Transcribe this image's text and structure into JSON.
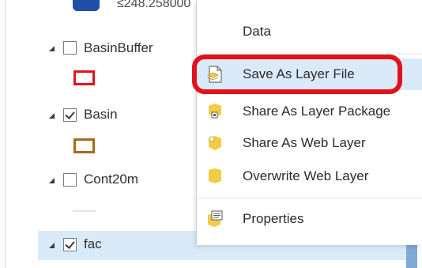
{
  "contents": {
    "prev_legend_label": "≤248.258000",
    "layers": [
      {
        "name": "BasinBuffer",
        "checked": false,
        "symbol_color": "#e8101a"
      },
      {
        "name": "Basin",
        "checked": true,
        "symbol_color": "#a66a19"
      },
      {
        "name": "Cont20m",
        "checked": false,
        "symbol_color": "#e3e3e3"
      },
      {
        "name": "fac",
        "checked": true,
        "selected": true
      }
    ]
  },
  "context_menu": {
    "items": [
      {
        "label": "Data",
        "icon": null
      },
      {
        "label": "Save As Layer File",
        "icon": "save-layer-file-icon",
        "highlighted": true
      },
      {
        "label": "Share As Layer Package",
        "icon": "layer-package-icon"
      },
      {
        "label": "Share As Web Layer",
        "icon": "web-layer-icon"
      },
      {
        "label": "Overwrite Web Layer",
        "icon": "overwrite-web-layer-icon"
      },
      {
        "label": "Properties",
        "icon": "properties-icon"
      }
    ]
  },
  "colors": {
    "accent_highlight": "#e2111b",
    "selection": "#d9ebf9"
  }
}
